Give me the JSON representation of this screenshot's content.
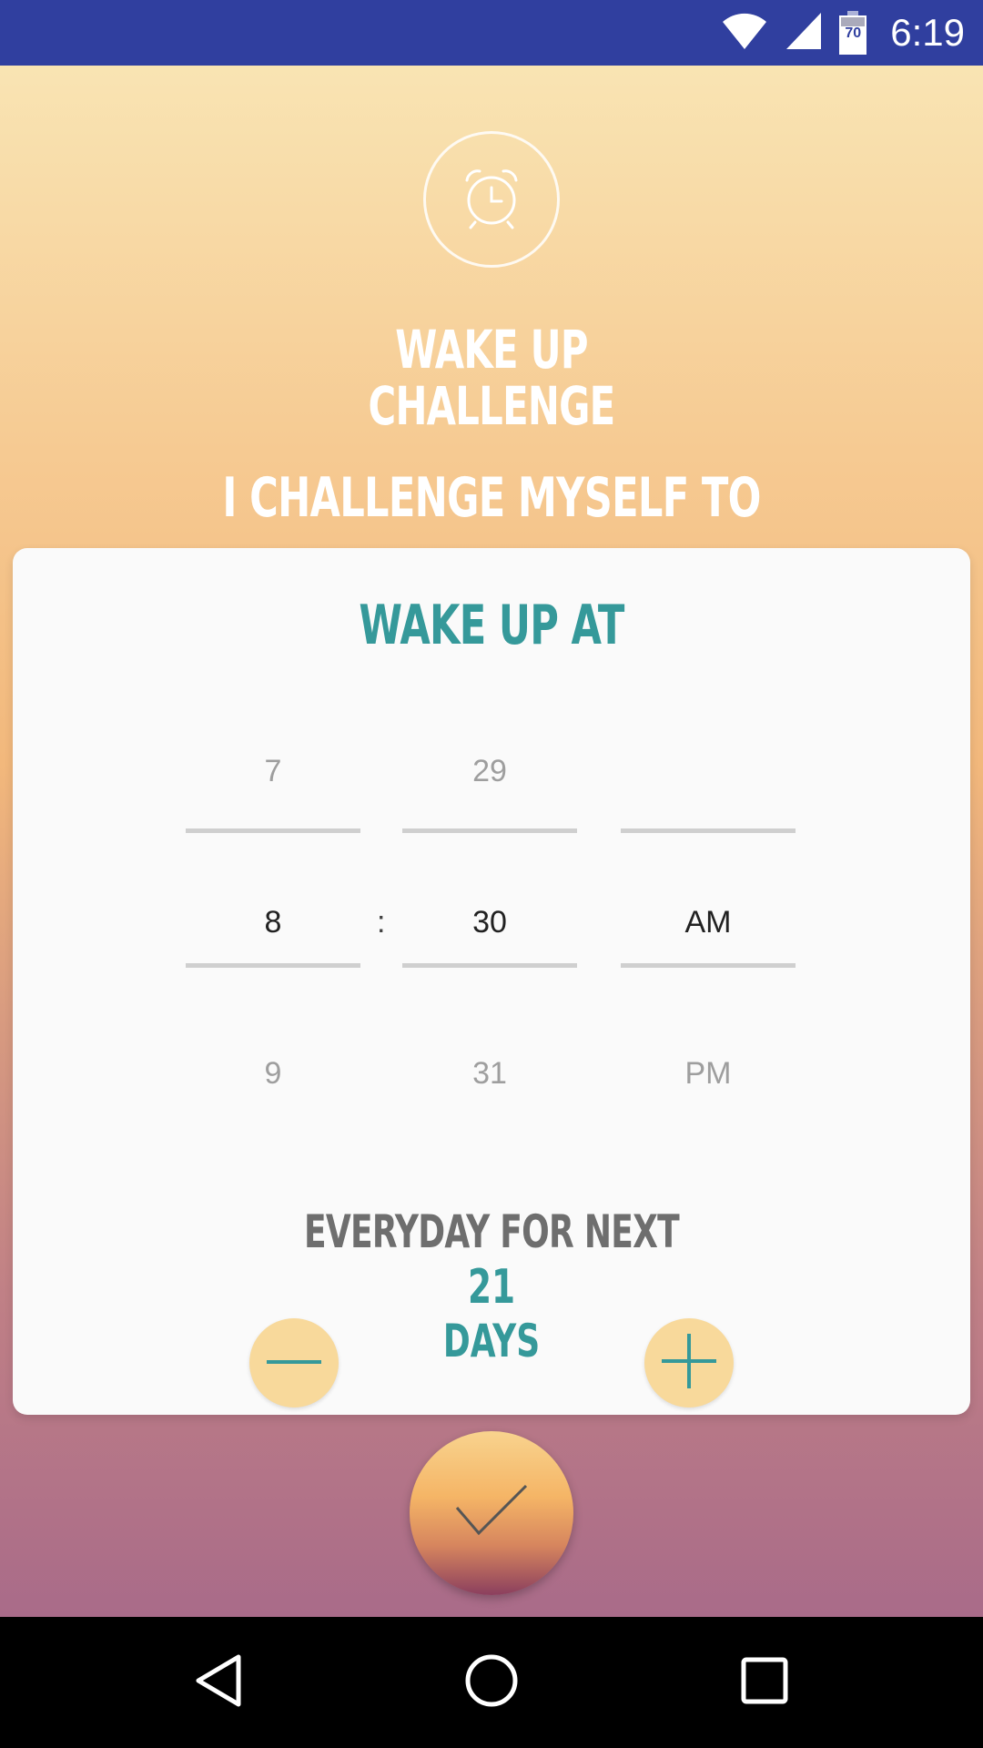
{
  "status_bar": {
    "time": "6:19",
    "battery_level": "70",
    "icons": [
      "wifi-icon",
      "cell-signal-icon",
      "battery-icon"
    ],
    "background": "#303f9f"
  },
  "header": {
    "icon": "alarm-clock-icon",
    "title_line1": "WAKE UP",
    "title_line2": "CHALLENGE",
    "subtitle": "I CHALLENGE MYSELF TO"
  },
  "card": {
    "title": "WAKE UP AT",
    "time_picker": {
      "hour": {
        "previous": "7",
        "selected": "8",
        "next": "9"
      },
      "separator": ":",
      "minute": {
        "previous": "29",
        "selected": "30",
        "next": "31"
      },
      "period": {
        "previous": "",
        "selected": "AM",
        "next": "PM"
      }
    },
    "duration_label": "EVERYDAY FOR NEXT",
    "days_value": "21",
    "days_unit": "DAYS",
    "decrement_icon": "minus-icon",
    "increment_icon": "plus-icon"
  },
  "confirm": {
    "icon": "checkmark-icon"
  },
  "navigation": {
    "icons": [
      "back-icon",
      "home-icon",
      "recents-icon"
    ]
  },
  "colors": {
    "accent": "#35999a",
    "button_fill": "#f8d99b",
    "gradient_top": "#f9e4b3",
    "gradient_bottom": "#a96b89"
  }
}
